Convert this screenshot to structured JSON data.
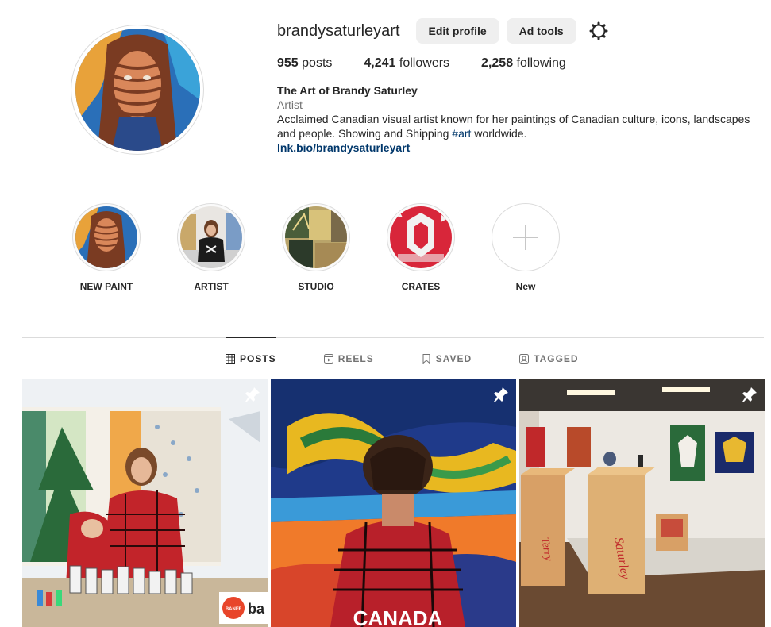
{
  "profile": {
    "username": "brandysaturleyart",
    "edit_profile_label": "Edit profile",
    "ad_tools_label": "Ad tools",
    "posts_count": "955",
    "posts_label": "posts",
    "followers_count": "4,241",
    "followers_label": "followers",
    "following_count": "2,258",
    "following_label": "following",
    "display_name": "The Art of Brandy Saturley",
    "category": "Artist",
    "bio_before": "Acclaimed Canadian visual artist known for her paintings of Canadian culture, icons, landscapes and people. Showing and Shipping ",
    "bio_hashtag": "#art",
    "bio_after": " worldwide.",
    "link": "lnk.bio/brandysaturleyart"
  },
  "highlights": [
    {
      "label": "NEW PAINT"
    },
    {
      "label": "ARTIST"
    },
    {
      "label": "STUDIO"
    },
    {
      "label": "CRATES"
    },
    {
      "label": "New"
    }
  ],
  "tabs": [
    {
      "label": "POSTS",
      "icon": "grid-icon",
      "active": true
    },
    {
      "label": "REELS",
      "icon": "reels-icon",
      "active": false
    },
    {
      "label": "SAVED",
      "icon": "bookmark-icon",
      "active": false
    },
    {
      "label": "TAGGED",
      "icon": "tagged-icon",
      "active": false
    }
  ],
  "posts": [
    {
      "pinned": true,
      "overlay_text": "ba"
    },
    {
      "pinned": true,
      "overlay_text": "CANADA"
    },
    {
      "pinned": true,
      "overlay_text": ""
    }
  ],
  "colors": {
    "text": "#262626",
    "muted": "#737373",
    "link": "#00376b",
    "button_bg": "#efefef",
    "border": "#dbdbdb"
  }
}
